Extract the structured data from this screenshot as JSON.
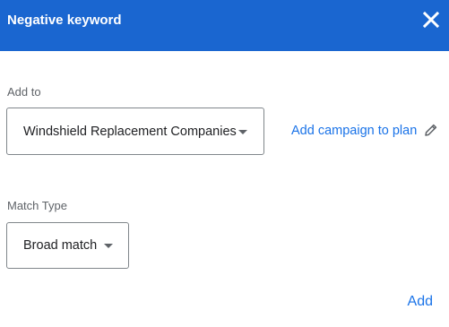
{
  "dialog": {
    "title": "Negative keyword"
  },
  "add_to": {
    "label": "Add to",
    "selected": "Windshield Replacement Companies",
    "link_label": "Add campaign to plan"
  },
  "match_type": {
    "label": "Match Type",
    "selected": "Broad match"
  },
  "actions": {
    "add_label": "Add"
  },
  "icons": {
    "close": "close-icon",
    "dropdown": "dropdown-caret-icon",
    "edit": "pencil-icon"
  },
  "colors": {
    "header_bg": "#1a66d0",
    "accent": "#1a73e8",
    "border": "#80868b"
  }
}
